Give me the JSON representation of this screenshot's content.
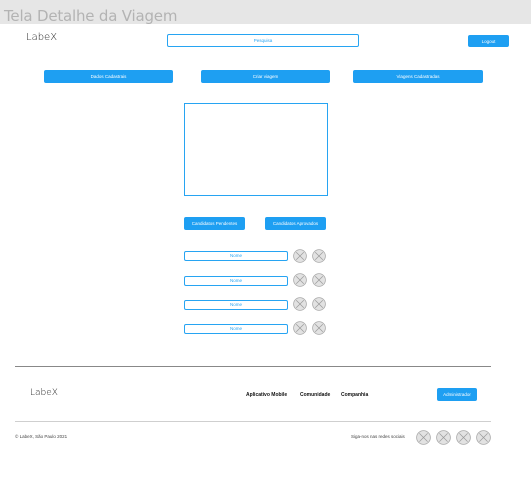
{
  "frame_title": "Tela Detalhe da Viagem",
  "header": {
    "logo": "LabeX",
    "search_placeholder": "Pesquisa",
    "logout_label": "Logout"
  },
  "nav": {
    "dados_label": "Dados Cadastrais",
    "criar_label": "Criar viagem",
    "viagens_label": "Viagens Cadastradas"
  },
  "candidates": {
    "pending_label": "Candidatos Pendentes",
    "approved_label": "Candidatos Aprovados",
    "rows": [
      {
        "name": "Nome"
      },
      {
        "name": "Nome"
      },
      {
        "name": "Nome"
      },
      {
        "name": "Nome"
      }
    ]
  },
  "footer": {
    "logo": "LabeX",
    "links": [
      "Aplicativo Mobile",
      "Comunidade",
      "Companhia"
    ],
    "admin_label": "Administrador",
    "copyright": "© LabeX, São Paulo 2021",
    "social_text": "Siga-nos nas redes sociais"
  }
}
